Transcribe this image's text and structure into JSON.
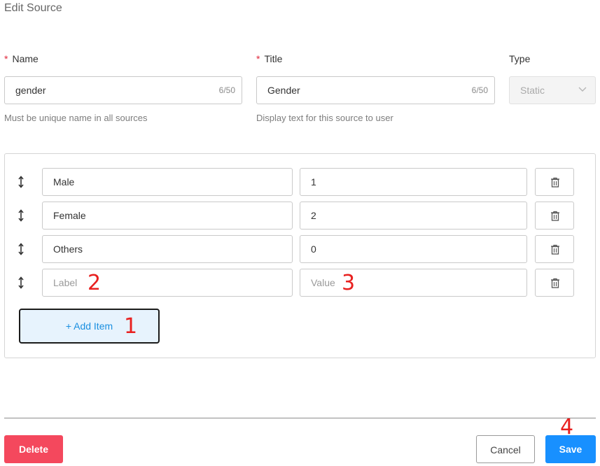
{
  "dialog": {
    "title": "Edit Source"
  },
  "form": {
    "name": {
      "label": "Name",
      "required_mark": "*",
      "value": "gender",
      "counter": "6/50",
      "helper": "Must be unique name in all sources"
    },
    "title": {
      "label": "Title",
      "required_mark": "*",
      "value": "Gender",
      "counter": "6/50",
      "helper": "Display text for this source to user"
    },
    "type": {
      "label": "Type",
      "value": "Static",
      "disabled": true
    }
  },
  "items": [
    {
      "label": "Male",
      "value": "1"
    },
    {
      "label": "Female",
      "value": "2"
    },
    {
      "label": "Others",
      "value": "0"
    }
  ],
  "new_item": {
    "label_placeholder": "Label",
    "value_placeholder": "Value"
  },
  "add_item": {
    "label": "+ Add Item"
  },
  "annotations": {
    "add_item": "1",
    "label_input": "2",
    "value_input": "3",
    "save": "4"
  },
  "footer": {
    "delete_label": "Delete",
    "cancel_label": "Cancel",
    "save_label": "Save"
  },
  "colors": {
    "accent": "#1890ff",
    "danger": "#f4485d",
    "required": "#e0283c",
    "annotation": "#e8201f"
  },
  "icons": {
    "drag": "drag-vertical-icon",
    "delete_row": "trash-icon",
    "dropdown": "chevron-down-icon"
  }
}
